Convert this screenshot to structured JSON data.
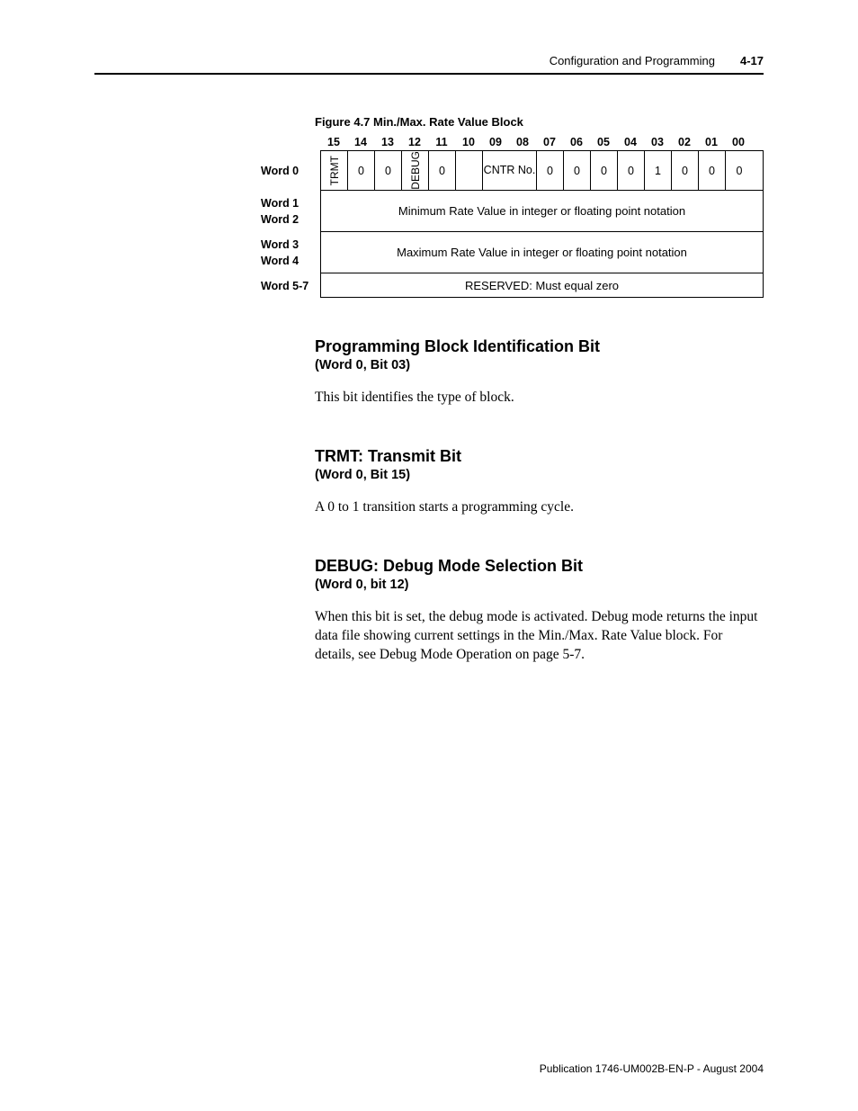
{
  "header": {
    "title": "Configuration and Programming",
    "pagenum": "4-17"
  },
  "figure": {
    "caption": "Figure 4.7 Min./Max. Rate Value Block",
    "bits": [
      "15",
      "14",
      "13",
      "12",
      "11",
      "10",
      "09",
      "08",
      "07",
      "06",
      "05",
      "04",
      "03",
      "02",
      "01",
      "00"
    ],
    "rowlabels": {
      "w0": "Word 0",
      "w1": "Word 1",
      "w2": "Word 2",
      "w3": "Word 3",
      "w4": "Word 4",
      "w57": "Word 5-7"
    },
    "w0": {
      "b15": "TRMT",
      "b14": "0",
      "b13": "0",
      "b12": "DEBUG",
      "b11": "0",
      "b10": "",
      "b0908": "CNTR No.",
      "b07": "0",
      "b06": "0",
      "b05": "0",
      "b04": "0",
      "b03": "1",
      "b02": "0",
      "b01": "0",
      "b00": "0"
    },
    "row12": "Minimum Rate Value in integer or floating point notation",
    "row34": "Maximum Rate Value in integer or floating point notation",
    "row57": "RESERVED: Must equal zero"
  },
  "sections": [
    {
      "h1": "Programming Block Identification Bit",
      "h2": "(Word 0, Bit 03)",
      "body": "This bit identifies the type of block."
    },
    {
      "h1": "TRMT: Transmit Bit",
      "h2": "(Word 0, Bit 15)",
      "body": "A 0 to 1 transition starts a programming cycle."
    },
    {
      "h1": "DEBUG: Debug Mode Selection Bit",
      "h2": "(Word 0, bit 12)",
      "body": "When this bit is set, the debug mode is activated. Debug mode returns the input data file showing current settings in the Min./Max. Rate Value block. For details, see Debug Mode Operation on page 5-7."
    }
  ],
  "footer": "Publication 1746-UM002B-EN-P - August 2004"
}
